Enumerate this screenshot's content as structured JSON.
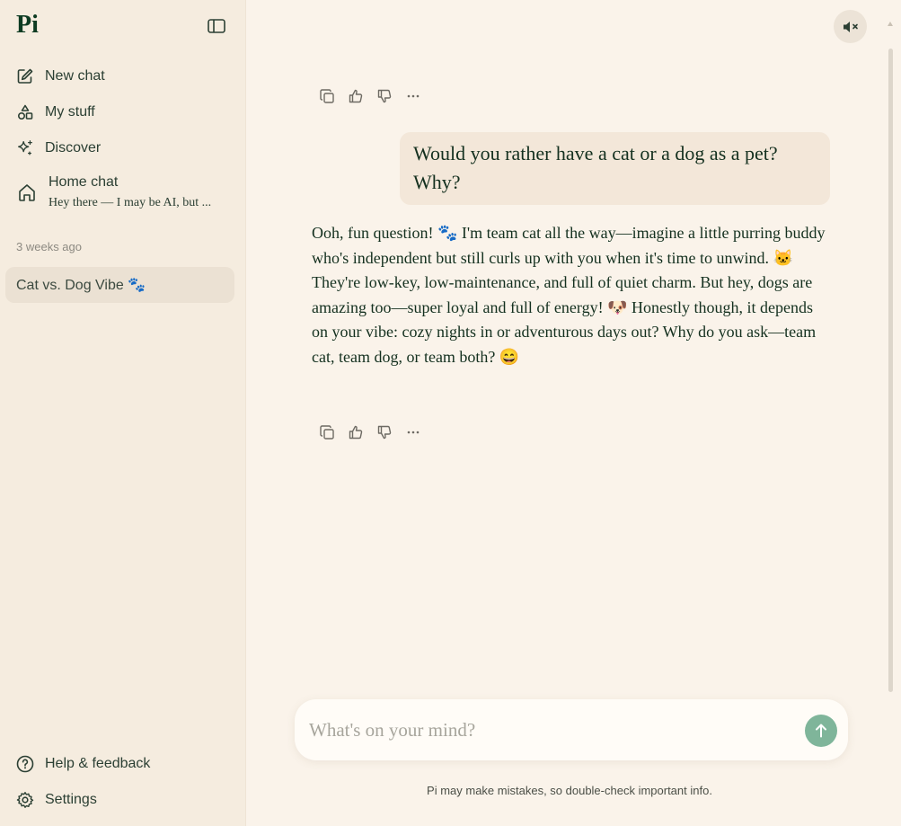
{
  "sidebar": {
    "logo": "Pi",
    "nav": {
      "new_chat": "New chat",
      "my_stuff": "My stuff",
      "discover": "Discover"
    },
    "home_chat": {
      "title": "Home chat",
      "preview": "Hey there — I may be AI, but ..."
    },
    "section_label": "3 weeks ago",
    "conversations": [
      {
        "label": "Cat vs. Dog Vibe 🐾"
      }
    ],
    "bottom": {
      "help": "Help & feedback",
      "settings": "Settings"
    }
  },
  "chat": {
    "user_message": "Would you rather have a cat or a dog as a pet? Why?",
    "ai_message": "Ooh, fun question! 🐾 I'm team cat all the way—imagine a little purring buddy who's independent but still curls up with you when it's time to unwind. 🐱 They're low-key, low-maintenance, and full of quiet charm. But hey, dogs are amazing too—super loyal and full of energy! 🐶 Honestly though, it depends on your vibe: cozy nights in or adventurous days out? Why do you ask—team cat, team dog, or team both? 😄"
  },
  "composer": {
    "placeholder": "What's on your mind?",
    "value": ""
  },
  "disclaimer": "Pi may make mistakes, so double-check important info.",
  "colors": {
    "background": "#faf3ea",
    "sidebar": "#f5ecdf",
    "user_bubble": "#f3e7d9",
    "selected_conversation": "#ebe1d3",
    "send_button": "#7fb59a",
    "text": "#14301f"
  },
  "icons": {
    "collapse": "sidebar-toggle-icon",
    "mute": "speaker-muted-icon",
    "copy": "copy-icon",
    "like": "thumbs-up-icon",
    "dislike": "thumbs-down-icon",
    "more": "more-dots-icon",
    "send": "arrow-up-icon"
  }
}
